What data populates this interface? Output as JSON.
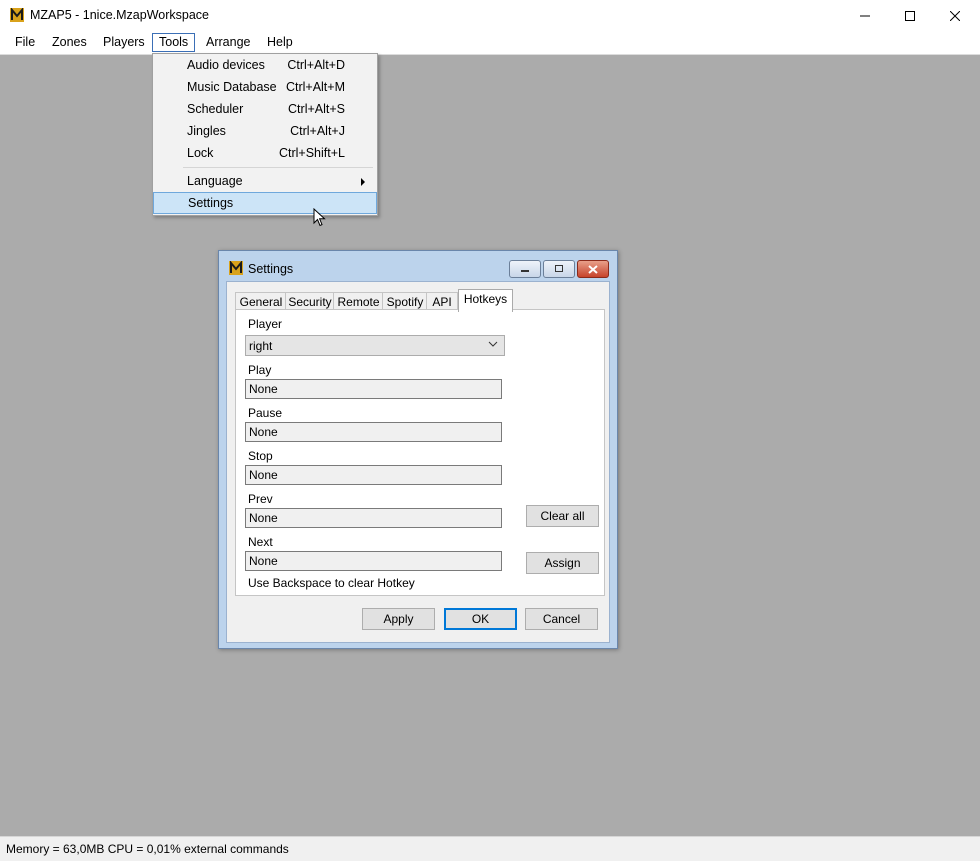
{
  "window": {
    "title": "MZAP5 - 1nice.MzapWorkspace"
  },
  "menubar": [
    "File",
    "Zones",
    "Players",
    "Tools",
    "Arrange",
    "Help"
  ],
  "tools_menu": {
    "items": [
      {
        "label": "Audio devices",
        "shortcut": "Ctrl+Alt+D"
      },
      {
        "label": "Music Database",
        "shortcut": "Ctrl+Alt+M"
      },
      {
        "label": "Scheduler",
        "shortcut": "Ctrl+Alt+S"
      },
      {
        "label": "Jingles",
        "shortcut": "Ctrl+Alt+J"
      },
      {
        "label": "Lock",
        "shortcut": "Ctrl+Shift+L"
      }
    ],
    "language": "Language",
    "settings": "Settings"
  },
  "dialog": {
    "title": "Settings",
    "tabs": [
      "General",
      "Security",
      "Remote",
      "Spotify",
      "API",
      "Hotkeys"
    ],
    "active_tab": "Hotkeys",
    "player_label": "Player",
    "player_value": "right",
    "hotkeys": [
      {
        "label": "Play",
        "value": "None"
      },
      {
        "label": "Pause",
        "value": "None"
      },
      {
        "label": "Stop",
        "value": "None"
      },
      {
        "label": "Prev",
        "value": "None"
      },
      {
        "label": "Next",
        "value": "None"
      }
    ],
    "hint": "Use Backspace to clear Hotkey",
    "clear_all": "Clear all",
    "assign": "Assign",
    "apply": "Apply",
    "ok": "OK",
    "cancel": "Cancel"
  },
  "status": "Memory = 63,0MB CPU = 0,01%  external commands"
}
